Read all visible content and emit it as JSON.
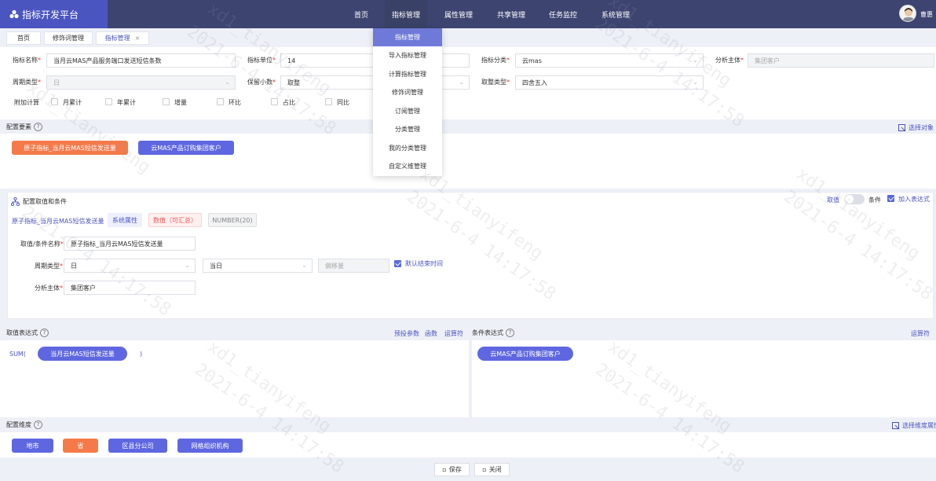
{
  "app": {
    "title": "指标开发平台",
    "user": "曹惠"
  },
  "nav": [
    {
      "label": "首页"
    },
    {
      "label": "指标管理"
    },
    {
      "label": "属性管理"
    },
    {
      "label": "共享管理"
    },
    {
      "label": "任务监控"
    },
    {
      "label": "系统管理"
    }
  ],
  "tabs": [
    {
      "label": "首页"
    },
    {
      "label": "修饰词管理"
    },
    {
      "label": "指标管理",
      "close": "×"
    }
  ],
  "dropdown": [
    "指标管理",
    "导入指标管理",
    "计算指标管理",
    "修饰词管理",
    "订阅管理",
    "分类管理",
    "我的分类管理",
    "自定义维管理"
  ],
  "form": {
    "name_label": "指标名称",
    "name_value": "当月云MAS产品服务端口发送短信条数",
    "unit_label": "指标单位",
    "unit_value": "14",
    "category_label": "指标分类",
    "category_value": "云mas",
    "subject_label": "分析主体",
    "subject_value": "集团客户",
    "period_label": "周期类型",
    "period_value": "日",
    "decimals_label": "保留小数",
    "decimals_value": "取整",
    "rounding_label": "取整类型",
    "rounding_value": "四舍五入",
    "extra_label": "附加计算",
    "extras": [
      "月累计",
      "年累计",
      "增量",
      "环比",
      "占比",
      "同比"
    ]
  },
  "elements": {
    "title": "配置要素",
    "help": "?",
    "select_link": "选择对象",
    "buttons": [
      "原子指标_当月云MAS短信发送量",
      "云MAS产品订购集团客户"
    ]
  },
  "conditions": {
    "title": "配置取值和条件",
    "switch_left": "取值",
    "switch_right": "条件",
    "add_expr": "加入表达式",
    "atom": "原子指标_当月云MAS短信发送量",
    "tags": [
      "系统属性",
      "数值（可汇总）",
      "NUMBER(20)"
    ],
    "value_name_label": "取值/条件名称",
    "value_name": "原子指标_当月云MAS短信发送量",
    "period_label": "周期类型",
    "period_value": "日",
    "period_value2": "当日",
    "offset_placeholder": "偏移量",
    "default_end": "默认结束时间",
    "subject_label": "分析主体",
    "subject_value": "集团客户"
  },
  "value_expr": {
    "title": "取值表达式",
    "links": [
      "预投参数",
      "函数",
      "运算符"
    ],
    "prefix": "SUM(",
    "pill": "当月云MAS短信发送量",
    "suffix": ")"
  },
  "cond_expr": {
    "title": "条件表达式",
    "link": "运算符",
    "pill": "云MAS产品订购集团客户"
  },
  "dimensions": {
    "title": "配置维度",
    "select_link": "选择维度属性",
    "buttons": [
      "地市",
      "省",
      "区县分公司",
      "网格组织机构"
    ]
  },
  "footer": {
    "save": "保存",
    "close": "关闭"
  },
  "watermark": {
    "line1": "xd1_tianyifeng",
    "line2": "2021-6-4 14:17:58"
  },
  "colors": {
    "brand": "#4a55c0",
    "topbar": "#3d4470",
    "orange": "#f57a4a",
    "purple": "#5f67e0"
  }
}
